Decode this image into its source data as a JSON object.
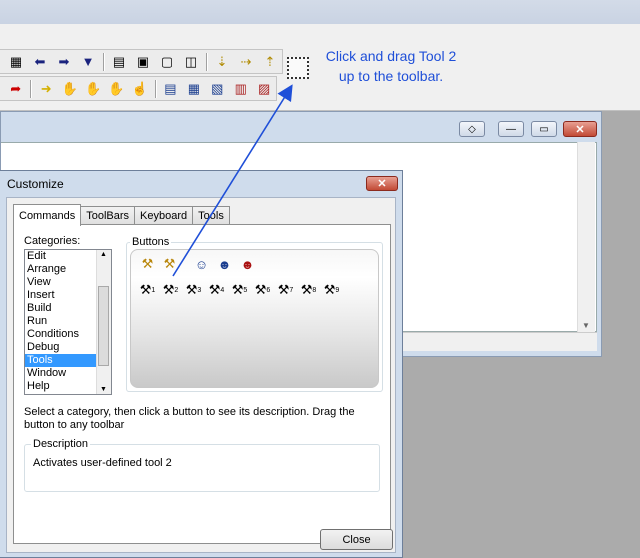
{
  "callout": {
    "line1": "Click and drag Tool 2",
    "line2": "up to the toolbar."
  },
  "toolbar": {
    "row1_icons": [
      "window-list-icon",
      "go-back-icon",
      "go-forward-icon",
      "dropdown-arrow-icon",
      "layout-1-icon",
      "layout-2-icon",
      "layout-3-icon",
      "layout-4-icon",
      "step-into-icon",
      "step-over-icon",
      "step-out-icon"
    ],
    "row2_icons": [
      "run-arrow-icon",
      "arrow-yellow-icon",
      "hand-icon",
      "hand-stop-icon",
      "hand-red-icon",
      "hand-cursor-icon",
      "dialog-1-icon",
      "dialog-2-icon",
      "dialog-3-icon",
      "dialog-4-icon",
      "dialog-5-icon"
    ]
  },
  "mdi_window": {
    "minimize": "—",
    "maximize": "▭",
    "restore": "◇",
    "close": "✕"
  },
  "dialog": {
    "title": "Customize",
    "close_glyph": "✕",
    "tabs": [
      "Commands",
      "ToolBars",
      "Keyboard",
      "Tools"
    ],
    "active_tab": "Commands",
    "categories_label": "Categories:",
    "categories": [
      "Edit",
      "Arrange",
      "View",
      "Insert",
      "Build",
      "Run",
      "Conditions",
      "Debug",
      "Tools",
      "Window",
      "Help"
    ],
    "selected_category": "Tools",
    "buttons_label": "Buttons",
    "buttons_row1": [
      "magic-wand-icon",
      "magic-wand-2-icon",
      "user-tool-1-icon",
      "user-tool-2-icon",
      "user-tool-3-icon"
    ],
    "tools_row": [
      {
        "icon": "tool-hammer-icon",
        "number": "1"
      },
      {
        "icon": "tool-hammer-icon",
        "number": "2"
      },
      {
        "icon": "tool-hammer-icon",
        "number": "3"
      },
      {
        "icon": "tool-hammer-icon",
        "number": "4"
      },
      {
        "icon": "tool-hammer-icon",
        "number": "5"
      },
      {
        "icon": "tool-hammer-icon",
        "number": "6"
      },
      {
        "icon": "tool-hammer-icon",
        "number": "7"
      },
      {
        "icon": "tool-hammer-icon",
        "number": "8"
      },
      {
        "icon": "tool-hammer-icon",
        "number": "9"
      }
    ],
    "help_text": "Select a category, then click a button to see its description. Drag the button to any toolbar",
    "description_label": "Description",
    "description_text": "Activates user-defined tool 2",
    "close_button": "Close"
  },
  "colors": {
    "accent": "#1f4fd8",
    "selection": "#3399ff",
    "close_red": "#c24a35"
  }
}
